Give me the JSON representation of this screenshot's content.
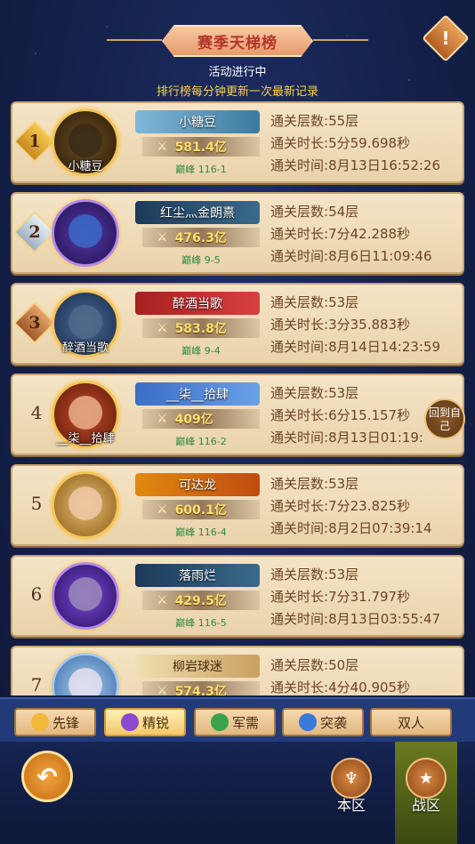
{
  "header": {
    "title": "赛季天梯榜",
    "status": "活动进行中",
    "subtitle": "排行榜每分钟更新一次最新记录",
    "warn_icon": "!"
  },
  "labels": {
    "floors": "通关层数:",
    "duration": "通关时长:",
    "time": "通关时间:"
  },
  "rows": [
    {
      "rank": "1",
      "avatar_name": "小糖豆",
      "player": "小糖豆",
      "power": "581.4亿",
      "peak": "巅峰 116-1",
      "floors": "55层",
      "duration": "5分59.698秒",
      "time": "8月13日16:52:26"
    },
    {
      "rank": "2",
      "avatar_name": "",
      "player": "红尘灬金朗熹",
      "power": "476.3亿",
      "peak": "巅峰 9-5",
      "floors": "54层",
      "duration": "7分42.288秒",
      "time": "8月6日11:09:46"
    },
    {
      "rank": "3",
      "avatar_name": "醉酒当歌",
      "player": "醉酒当歌",
      "power": "583.8亿",
      "peak": "巅峰 9-4",
      "floors": "53层",
      "duration": "3分35.883秒",
      "time": "8月14日14:23:59"
    },
    {
      "rank": "4",
      "avatar_name": "__柒__拾肆",
      "player": "__柒__拾肆",
      "power": "409亿",
      "peak": "巅峰 116-2",
      "floors": "53层",
      "duration": "6分15.157秒",
      "time": "8月13日01:19:"
    },
    {
      "rank": "5",
      "avatar_name": "",
      "player": "可达龙",
      "power": "600.1亿",
      "peak": "巅峰 116-4",
      "floors": "53层",
      "duration": "7分23.825秒",
      "time": "8月2日07:39:14"
    },
    {
      "rank": "6",
      "avatar_name": "",
      "player": "落雨烂",
      "power": "429.5亿",
      "peak": "巅峰 116-5",
      "floors": "53层",
      "duration": "7分31.797秒",
      "time": "8月13日03:55:47"
    },
    {
      "rank": "7",
      "avatar_name": "",
      "player": "柳岩球迷",
      "power": "574.3亿",
      "peak": "",
      "floors": "50层",
      "duration": "4分40.905秒",
      "time": ""
    }
  ],
  "back_to_me": "回到自己",
  "tabs": [
    {
      "label": "先锋",
      "icon": "shield-icon",
      "color": "#f2b93a"
    },
    {
      "label": "精锐",
      "icon": "spiral-icon",
      "color": "#8a4bd0"
    },
    {
      "label": "军需",
      "icon": "leaf-icon",
      "color": "#3aa24a"
    },
    {
      "label": "突袭",
      "icon": "swirl-icon",
      "color": "#3a7ad8"
    },
    {
      "label": "双人",
      "icon": "",
      "color": ""
    }
  ],
  "nav": {
    "local": "本区",
    "war": "战区",
    "back_arrow": "↶"
  },
  "colors": {
    "plate_gold": "#e79a30",
    "plate_blue": "#3a6ec8",
    "plate_red": "#c43a3a",
    "plate_dark": "#2a3a5a"
  }
}
